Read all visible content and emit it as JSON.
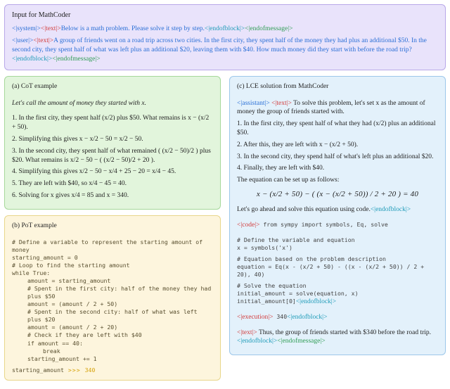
{
  "input": {
    "title": "Input for MathCoder",
    "tags": {
      "system_open": "<|system|>",
      "text_open": "<|text|>",
      "endofblock": "<|endofblock|>",
      "endofmessage": "<|endofmessage|>",
      "user_open": "<|user|>",
      "assistant_open": "<|assistant|>",
      "code_open": "<|code|>",
      "execution_open": "<|execution|>"
    },
    "system_text": "Below is a math problem. Please solve it step by step.",
    "user_text": "A group of friends went on a road trip across two cities. In the first city, they spent half of the money they had plus an additional $50. In the second city, they spent half of what was left plus an additional $20, leaving them with $40. How much money did they start with before the road trip?"
  },
  "cot": {
    "title": "(a) CoT example",
    "intro": "Let's call the amount of money they started with x.",
    "steps": [
      "1.  In the first city, they spent half (x/2) plus $50.  What remains is x − (x/2 + 50).",
      "2.  Simplifying this gives x − x/2 − 50 = x/2 − 50.",
      "3.  In the second city, they spent half of what remained ( (x/2 − 50)/2 ) plus $20. What remains is x/2 − 50 − ( (x/2 − 50)/2 + 20 ).",
      "4.  Simplifying this gives x/2 − 50 − x/4 + 25 − 20 = x/4 − 45.",
      "5.  They are left with $40, so x/4 − 45 = 40.",
      "6.  Solving for x gives x/4 = 85 and x = 340."
    ]
  },
  "pot": {
    "title": "(b) PoT example",
    "code": {
      "l1": "# Define a variable to represent the starting amount of money",
      "l2": "starting_amount = 0",
      "l3": "# Loop to find the starting amount",
      "l4": "while True:",
      "l5": "amount = starting_amount",
      "l6": "# Spent in the first city: half of the money they had plus $50",
      "l7": "amount = (amount / 2 + 50)",
      "l8": "# Spent in the second city: half of what was left plus $20",
      "l9": "amount = (amount / 2 + 20)",
      "l10": "# Check if they are left with $40",
      "l11": "if amount == 40:",
      "l12": "break",
      "l13": "starting_amount += 1",
      "out_label": "starting_amount",
      "out_arrows": " >>> ",
      "out_value": "340"
    }
  },
  "lce": {
    "title": "(c) LCE solution from MathCoder",
    "text1": " To solve this problem, let's set x as the amount of money the group of friends started with.",
    "step1": "1.  In the first city, they spent half of what they had (x/2) plus an additional $50.",
    "step2": "2.  After this, they are left with x − (x/2 + 50).",
    "step3": "3.  In the second city, they spend half of what's left plus an additional $20.",
    "step4": "4.  Finally, they are left with $40.",
    "eq_label": "The equation can be set up as follows:",
    "equation": "x − (x/2 + 50) − ( (x − (x/2 + 50)) / 2 + 20 ) = 40",
    "solve_prompt": "Let's go ahead and solve this equation using code.",
    "code": {
      "c1": " from sympy import symbols, Eq, solve",
      "c2": "# Define the variable and equation",
      "c3": "x = symbols('x')",
      "c4": "# Equation based on the problem description",
      "c5": "equation = Eq(x - (x/2 + 50) - ((x - (x/2 + 50)) / 2 + 20), 40)",
      "c6": "# Solve the equation",
      "c7": "initial_amount = solve(equation, x)",
      "c8": "initial_amount[0]"
    },
    "exec_result": " 340",
    "final_text": " Thus, the group of friends started with $340 before the road trip."
  }
}
